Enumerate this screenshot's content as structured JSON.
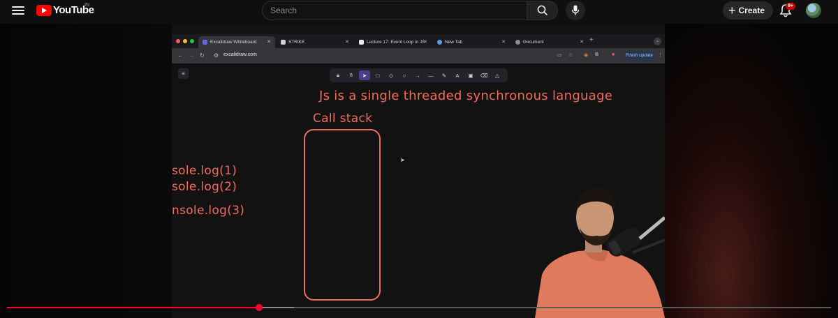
{
  "header": {
    "logo_text": "YouTube",
    "country_code": "IN",
    "search_placeholder": "Search",
    "create_label": "Create",
    "notification_count": "9+"
  },
  "video_frame": {
    "browser": {
      "tabs": [
        {
          "label": "Excalidraw Whiteboard",
          "icon": "excalidraw-icon",
          "active": true
        },
        {
          "label": "STRIKE",
          "icon": "strike-icon",
          "active": false
        },
        {
          "label": "Lecture 17: Event Loop in JS",
          "icon": "notion-icon",
          "active": false
        },
        {
          "label": "New Tab",
          "icon": "chrome-icon",
          "active": false
        },
        {
          "label": "Document",
          "icon": "globe-icon",
          "active": false
        }
      ],
      "url": "excalidraw.com",
      "finish_update_label": "Finish update"
    },
    "toolbar_tools": [
      "lock",
      "hand",
      "selection",
      "rectangle",
      "diamond",
      "ellipse",
      "arrow",
      "line",
      "draw",
      "text",
      "image",
      "eraser",
      "more"
    ],
    "selected_tool": "selection",
    "whiteboard": {
      "headline": "Js is a single threaded synchronous language",
      "call_stack_label": "Call stack",
      "code_lines": [
        "sole.log(1)",
        "sole.log(2)",
        "nsole.log(3)"
      ]
    }
  },
  "player": {
    "progress_fraction": 0.306,
    "buffered_fraction": 0.348,
    "colors": {
      "played": "#ff0033",
      "buffered": "#8c8c8c",
      "track": "#5a5a5a"
    }
  }
}
